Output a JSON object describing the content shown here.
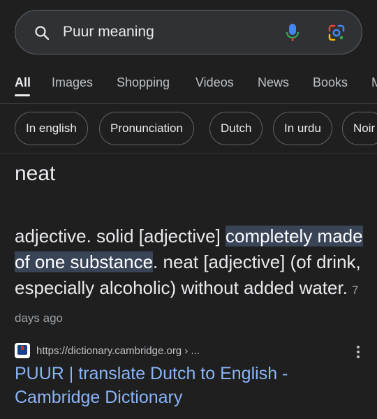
{
  "search": {
    "query": "Puur meaning"
  },
  "tabs": [
    "All",
    "Images",
    "Shopping",
    "Videos",
    "News",
    "Books",
    "M"
  ],
  "chips": [
    "In english",
    "Pronunciation",
    "Dutch",
    "In urdu",
    "Noir"
  ],
  "answer": {
    "word": "neat",
    "part1": "adjective. solid [adjective] ",
    "highlight": "completely made of one substance",
    "part2": ". neat [adjective] (of drink, especially alcoholic) without added water.",
    "time": "7 days ago"
  },
  "result": {
    "url": "https://dictionary.cambridge.org › ...",
    "title": "PUUR | translate Dutch to English - Cambridge Dictionary"
  },
  "colors": {
    "background": "#1f1f1f",
    "link": "#8ab4f8",
    "highlight": "#394457"
  }
}
